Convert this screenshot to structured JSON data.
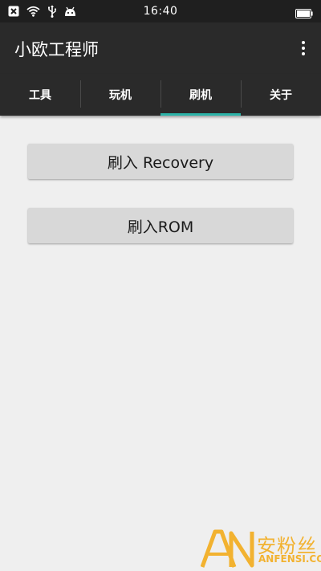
{
  "status_bar": {
    "time": "16:40",
    "icons": [
      "close-x-icon",
      "wifi-icon",
      "usb-icon",
      "android-icon",
      "battery-icon"
    ]
  },
  "app_bar": {
    "title": "小欧工程师",
    "menu_icon": "overflow-menu-icon"
  },
  "tabs": [
    {
      "label": "工具",
      "active": false
    },
    {
      "label": "玩机",
      "active": false
    },
    {
      "label": "刷机",
      "active": true
    },
    {
      "label": "关于",
      "active": false
    }
  ],
  "buttons": {
    "flash_recovery": "刷入 Recovery",
    "flash_rom": "刷入ROM"
  },
  "watermark": {
    "cn": "安粉丝",
    "en": "ANFENSI.COM"
  },
  "colors": {
    "status_bar": "#1f1f1f",
    "app_bar": "#2a2a2a",
    "tab_indicator": "#2bb3a8",
    "background": "#efefef",
    "button": "#d8d8d8",
    "watermark": "#f2b230"
  }
}
